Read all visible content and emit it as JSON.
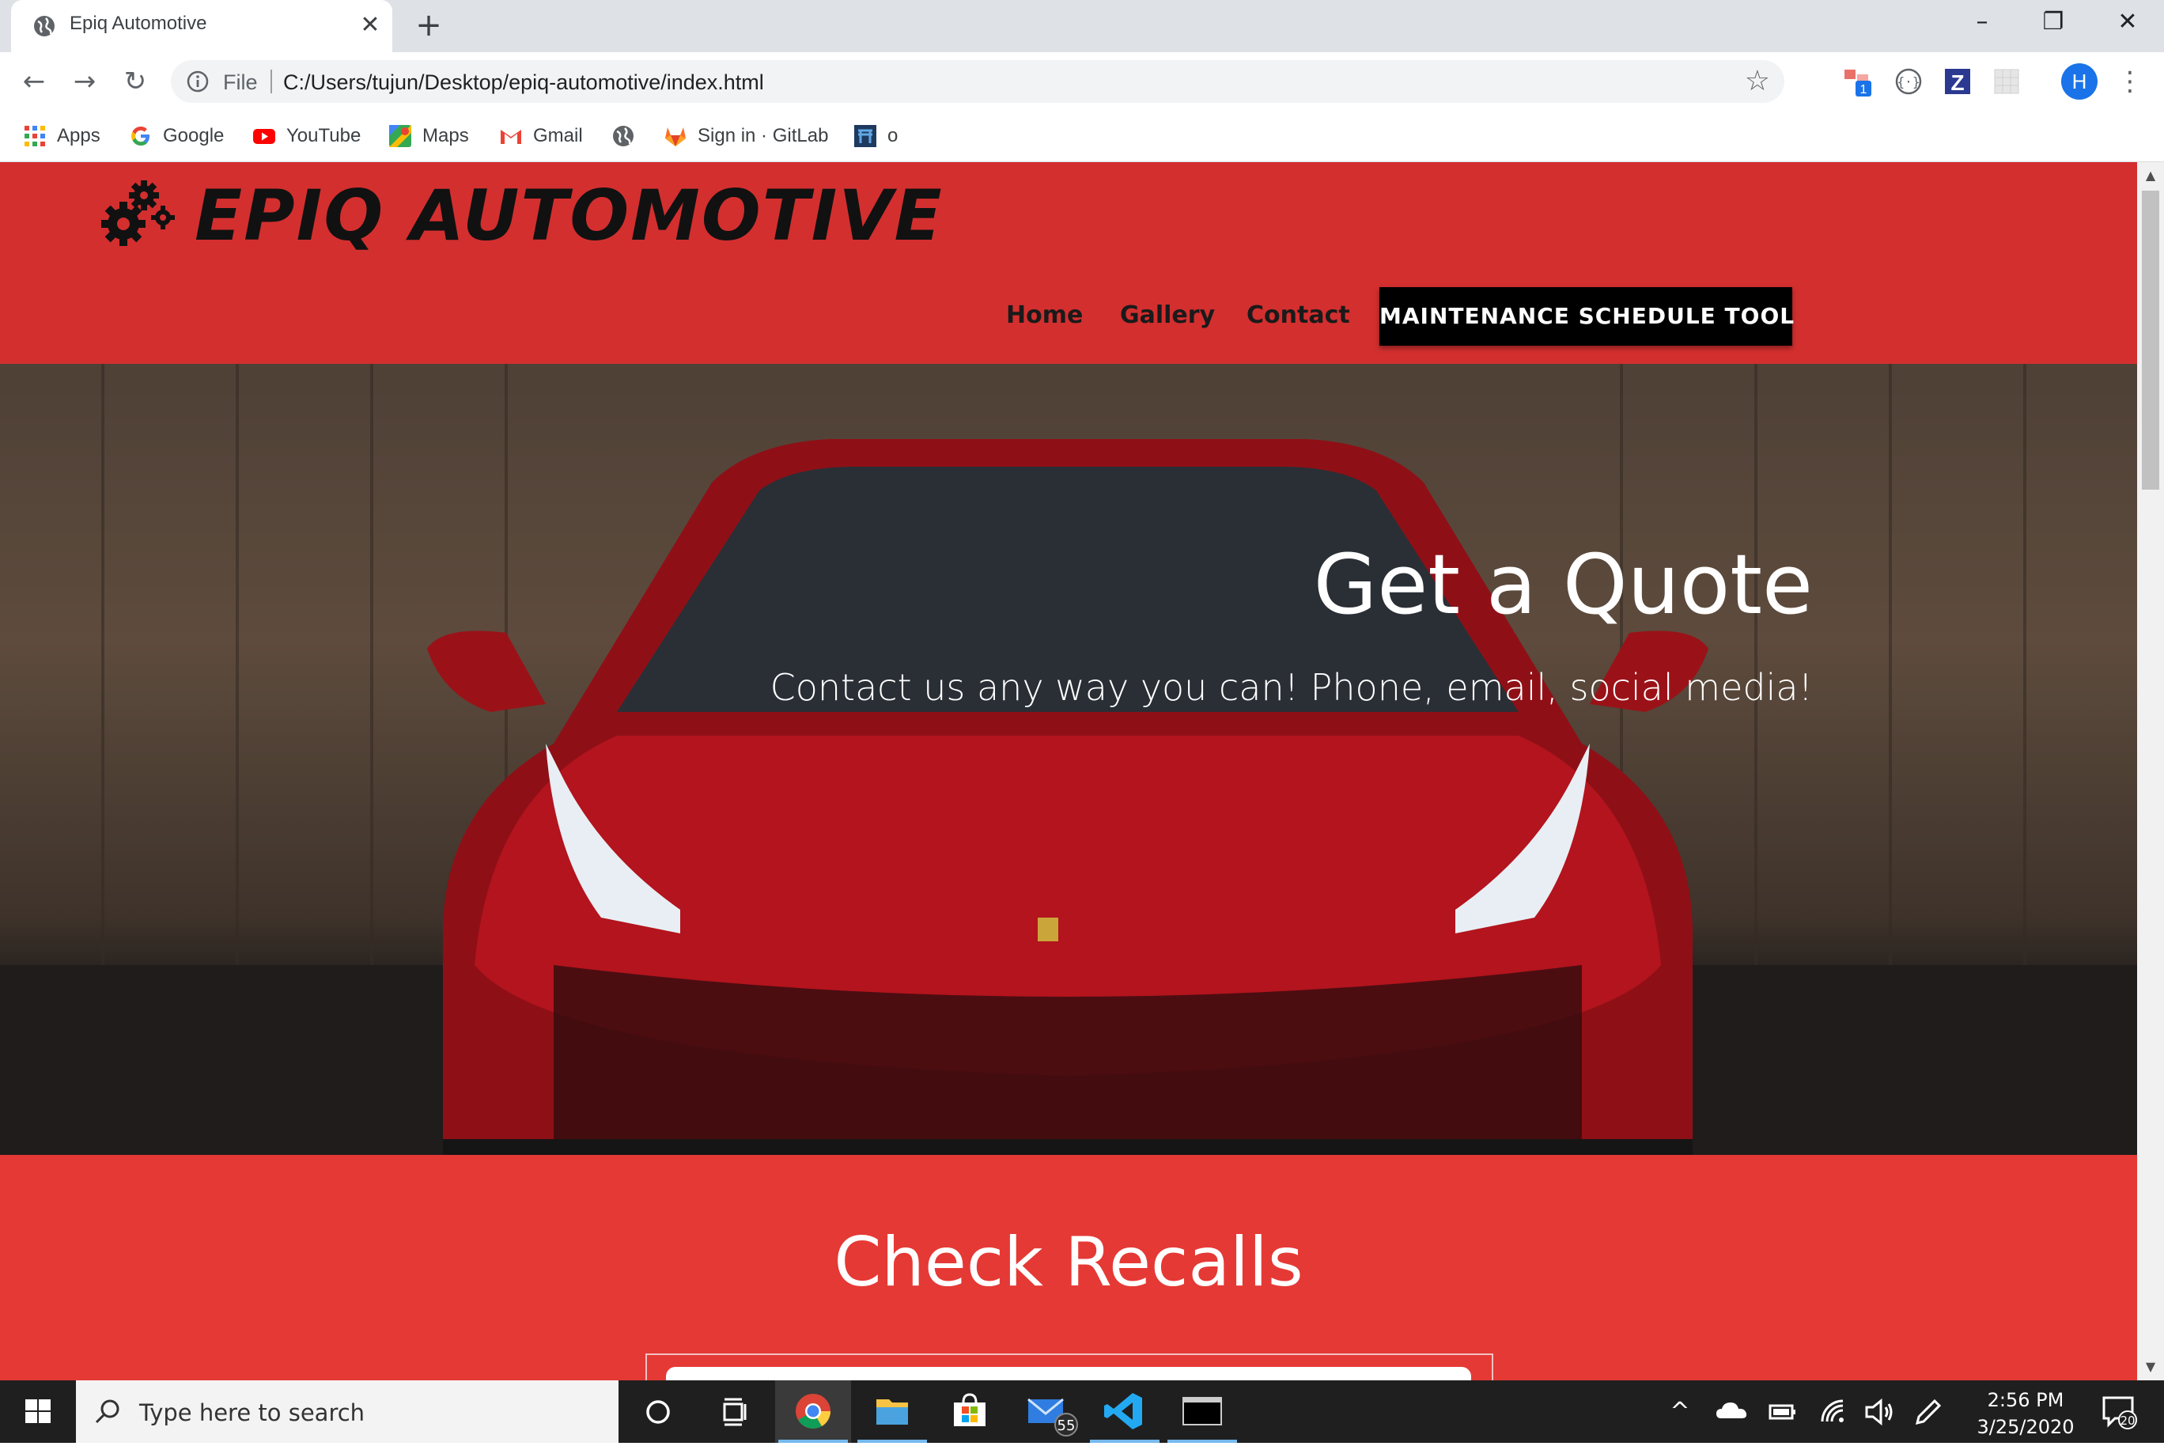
{
  "browser": {
    "tab_title": "Epiq Automotive",
    "new_tab_label": "+",
    "address_scheme": "File",
    "address_url": "C:/Users/tujun/Desktop/epiq-automotive/index.html",
    "profile_initial": "H",
    "extension_badge": "1"
  },
  "bookmarks": [
    {
      "label": "Apps",
      "icon": "apps-grid-icon"
    },
    {
      "label": "Google",
      "icon": "google-icon"
    },
    {
      "label": "YouTube",
      "icon": "youtube-icon"
    },
    {
      "label": "Maps",
      "icon": "maps-icon"
    },
    {
      "label": "Gmail",
      "icon": "gmail-icon"
    },
    {
      "label": "",
      "icon": "globe-icon"
    },
    {
      "label": "Sign in · GitLab",
      "icon": "gitlab-icon"
    },
    {
      "label": "o",
      "icon": "bookmark-app-icon"
    }
  ],
  "site": {
    "brand": "EPIQ AUTOMOTIVE",
    "nav": [
      "Home",
      "Gallery",
      "Contact"
    ],
    "cta": "MAINTENANCE SCHEDULE TOOL",
    "hero_title": "Get a Quote",
    "hero_subtitle": "Contact us any way you can! Phone, email, social media!",
    "recalls_title": "Check Recalls",
    "colors": {
      "header": "#d32f2f",
      "recalls": "#e53935",
      "cta": "#000000"
    }
  },
  "taskbar": {
    "search_placeholder": "Type here to search",
    "mail_badge": "55",
    "time": "2:56 PM",
    "date": "3/25/2020",
    "notification_count": "20"
  }
}
